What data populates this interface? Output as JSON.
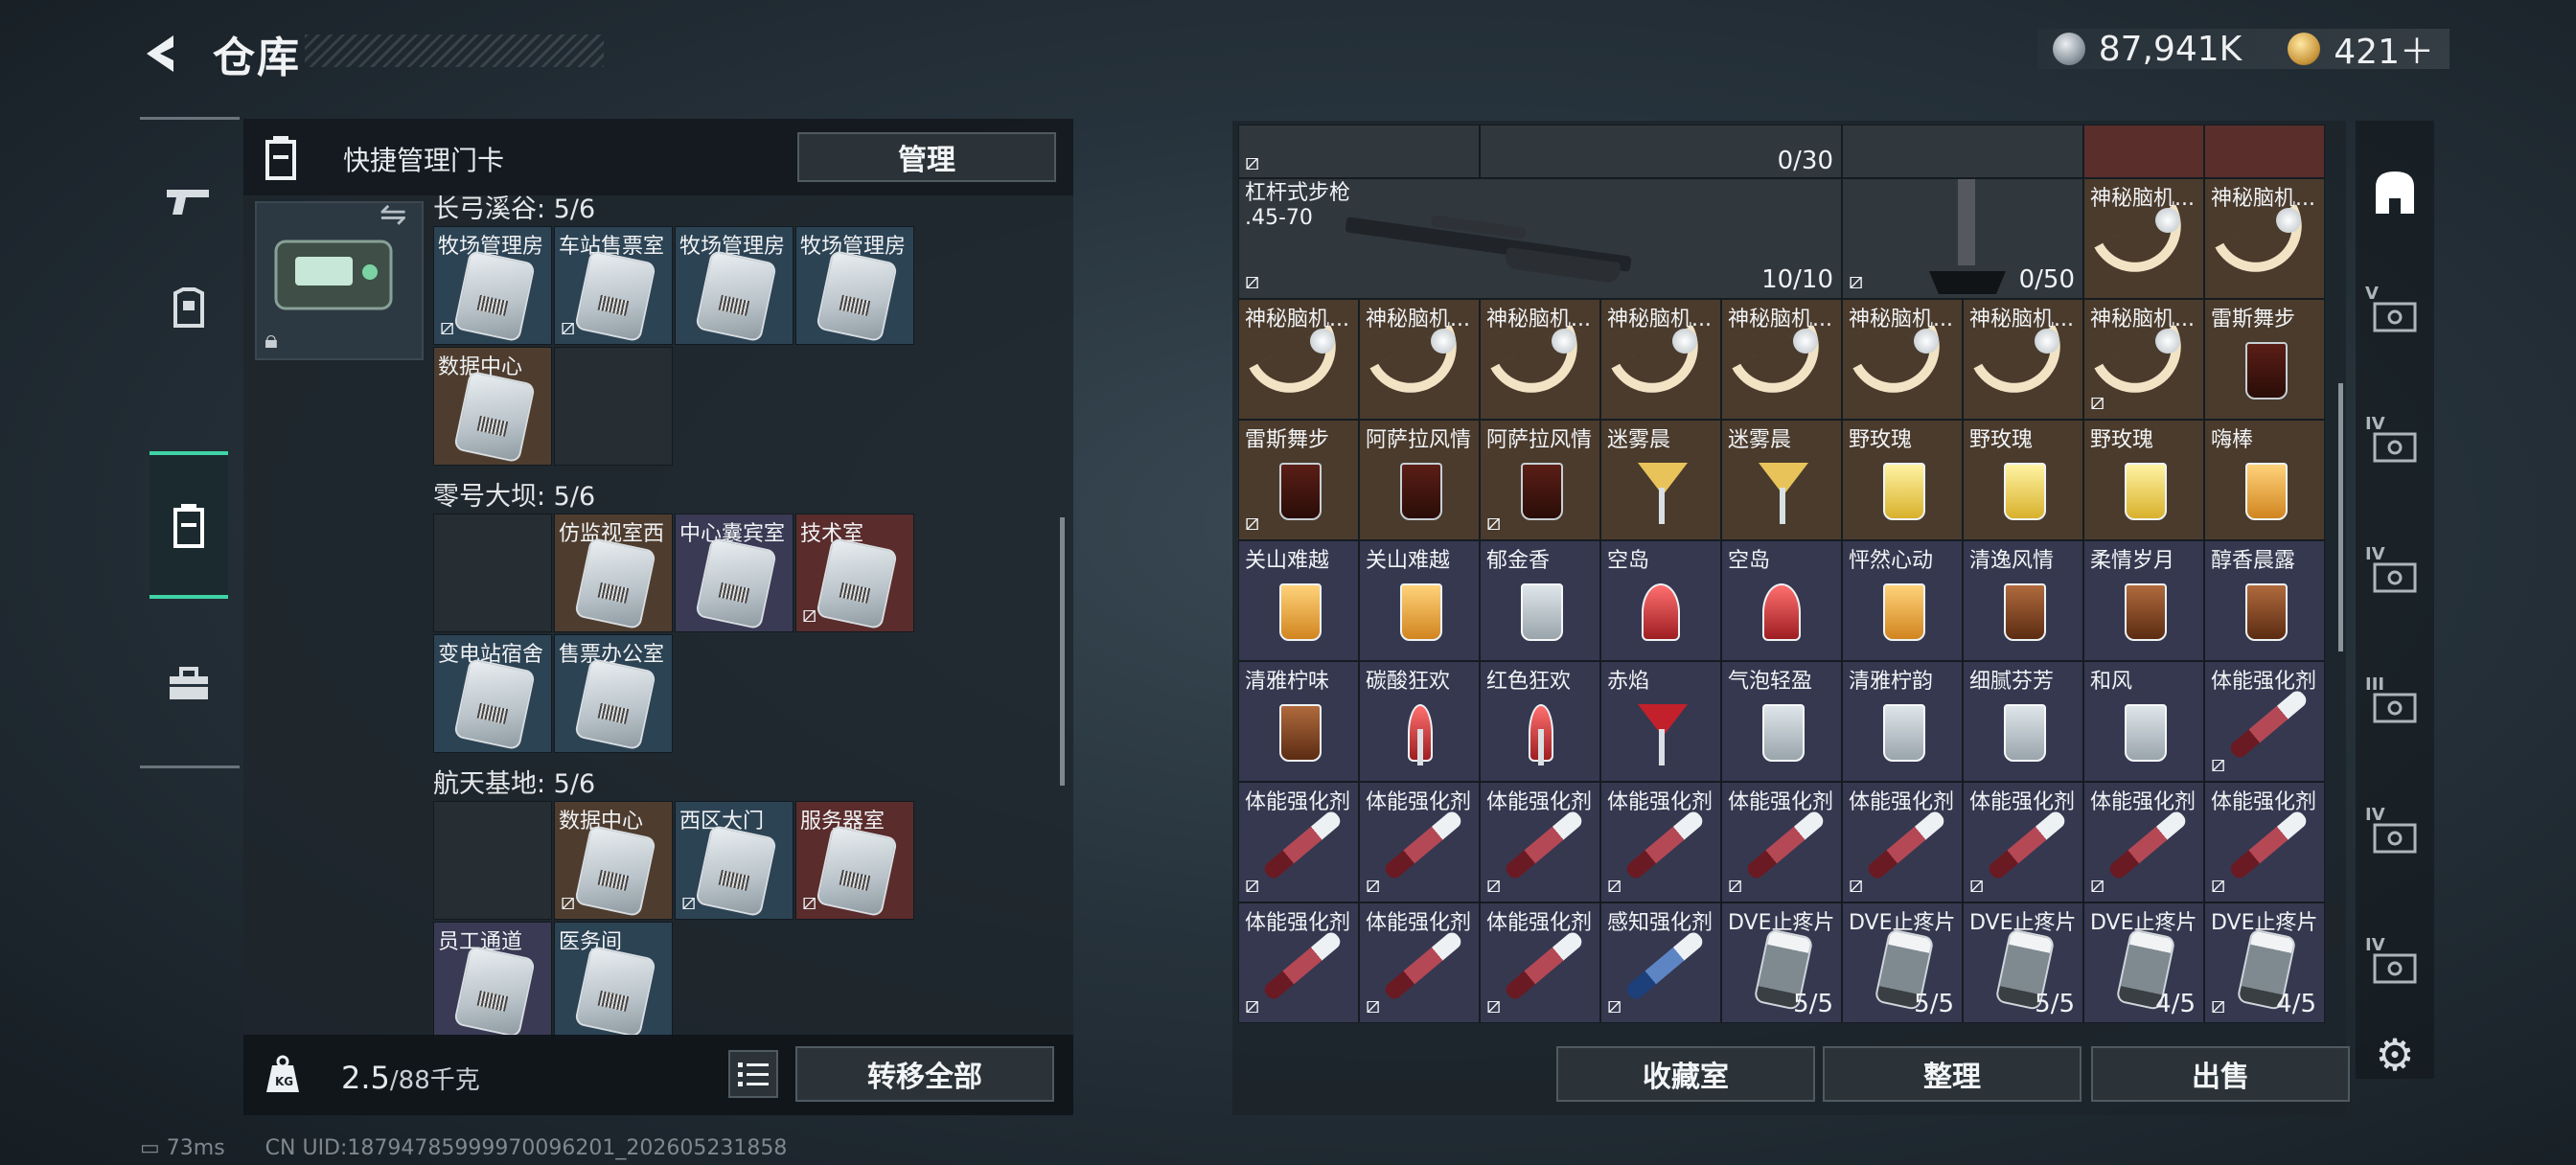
{
  "header": {
    "title": "仓库",
    "silver_amount": "87,941K",
    "gold_amount": "421＋",
    "silver_icon": "silver-coin-icon",
    "gold_icon": "gold-coin-icon"
  },
  "category_bar": {
    "items": [
      {
        "icon": "pistol-icon",
        "active": false
      },
      {
        "icon": "armor-icon",
        "active": false
      },
      {
        "icon": "keycard-case-icon",
        "active": true
      },
      {
        "icon": "toolbox-icon",
        "active": false
      }
    ]
  },
  "left_panel": {
    "header_label": "快捷管理门卡",
    "manage_label": "管理",
    "sections": [
      {
        "title": "长弓溪谷: 5/6",
        "cards": [
          {
            "label": "牧场管理房",
            "color": "blue",
            "flag": true
          },
          {
            "label": "车站售票室",
            "color": "blue",
            "flag": true
          },
          {
            "label": "牧场管理房",
            "color": "blue",
            "flag": false
          },
          {
            "label": "牧场管理房",
            "color": "blue",
            "flag": false
          },
          {
            "label": "数据中心",
            "color": "brown",
            "flag": false
          },
          {
            "label": "",
            "color": "empty",
            "flag": false
          }
        ]
      },
      {
        "title": "零号大坝: 5/6",
        "cards": [
          {
            "label": "",
            "color": "empty",
            "flag": false
          },
          {
            "label": "仿监视室西",
            "color": "brown",
            "flag": false
          },
          {
            "label": "中心囊宾室",
            "color": "purple",
            "flag": false
          },
          {
            "label": "技术室",
            "color": "red",
            "flag": true
          },
          {
            "label": "变电站宿舍",
            "color": "blue",
            "flag": false
          },
          {
            "label": "售票办公室",
            "color": "blue",
            "flag": false
          }
        ]
      },
      {
        "title": "航天基地: 5/6",
        "cards": [
          {
            "label": "",
            "color": "empty",
            "flag": false
          },
          {
            "label": "数据中心",
            "color": "brown",
            "flag": true
          },
          {
            "label": "西区大门",
            "color": "blue",
            "flag": true
          },
          {
            "label": "服务器室",
            "color": "red",
            "flag": true
          },
          {
            "label": "员工通道",
            "color": "purple",
            "flag": false
          },
          {
            "label": "医务间",
            "color": "blue",
            "flag": false
          }
        ]
      }
    ],
    "weight_value": "2.5",
    "weight_unit": "/88千克",
    "transfer_label": "转移全部"
  },
  "grid": {
    "row0": [
      {
        "label": "",
        "count": "",
        "color": "dark",
        "flag": true
      },
      {
        "label": "",
        "count": "0/30",
        "color": "dark",
        "flag": false
      }
    ],
    "rifle_label": "杠杆式步枪\n.45-70",
    "rifle_count": "10/10",
    "stand_count": "0/50",
    "rows": [
      [
        {
          "label": "神秘脑机...",
          "icon": "brain",
          "color": "brown",
          "flag": false
        },
        {
          "label": "神秘脑机...",
          "icon": "brain",
          "color": "brown",
          "flag": false
        },
        {
          "label": "神秘脑机...",
          "icon": "brain",
          "color": "brown",
          "flag": false
        },
        {
          "label": "神秘脑机...",
          "icon": "brain",
          "color": "brown",
          "flag": false
        },
        {
          "label": "神秘脑机...",
          "icon": "brain",
          "color": "brown",
          "flag": false
        },
        {
          "label": "神秘脑机...",
          "icon": "brain",
          "color": "brown",
          "flag": false
        },
        {
          "label": "神秘脑机...",
          "icon": "brain",
          "color": "brown",
          "flag": false
        },
        {
          "label": "神秘脑机...",
          "icon": "brain",
          "color": "brown",
          "flag": true
        },
        {
          "label": "雷斯舞步",
          "icon": "dark",
          "color": "brown",
          "flag": false
        }
      ],
      [
        {
          "label": "雷斯舞步",
          "icon": "dark",
          "color": "brown",
          "flag": true
        },
        {
          "label": "阿萨拉风情",
          "icon": "dark",
          "color": "brown",
          "flag": false
        },
        {
          "label": "阿萨拉风情",
          "icon": "dark",
          "color": "brown",
          "flag": true
        },
        {
          "label": "迷雾晨",
          "icon": "yellowstem",
          "color": "brown",
          "flag": false
        },
        {
          "label": "迷雾晨",
          "icon": "yellowstem",
          "color": "brown",
          "flag": false
        },
        {
          "label": "野玫瑰",
          "icon": "yellow",
          "color": "brown",
          "flag": false
        },
        {
          "label": "野玫瑰",
          "icon": "yellow",
          "color": "brown",
          "flag": false
        },
        {
          "label": "野玫瑰",
          "icon": "yellow",
          "color": "brown",
          "flag": false
        },
        {
          "label": "嗨棒",
          "icon": "amber",
          "color": "brown",
          "flag": false
        }
      ],
      [
        {
          "label": "关山难越",
          "icon": "amber",
          "color": "purple",
          "flag": false
        },
        {
          "label": "关山难越",
          "icon": "amber",
          "color": "purple",
          "flag": false
        },
        {
          "label": "郁金香",
          "icon": "clear",
          "color": "purple",
          "flag": false
        },
        {
          "label": "空岛",
          "icon": "red",
          "color": "purple",
          "flag": false
        },
        {
          "label": "空岛",
          "icon": "red",
          "color": "purple",
          "flag": false
        },
        {
          "label": "怦然心动",
          "icon": "amber",
          "color": "purple",
          "flag": false
        },
        {
          "label": "清逸风情",
          "icon": "brownglass",
          "color": "purple",
          "flag": false
        },
        {
          "label": "柔情岁月",
          "icon": "brownglass",
          "color": "purple",
          "flag": false
        },
        {
          "label": "醇香晨露",
          "icon": "brownglass",
          "color": "purple",
          "flag": false
        }
      ],
      [
        {
          "label": "清雅柠味",
          "icon": "brownglass",
          "color": "purple",
          "flag": false
        },
        {
          "label": "碳酸狂欢",
          "icon": "redstem",
          "color": "purple",
          "flag": false
        },
        {
          "label": "红色狂欢",
          "icon": "redstem",
          "color": "purple",
          "flag": false
        },
        {
          "label": "赤焰",
          "icon": "cocktail",
          "color": "purple",
          "flag": false
        },
        {
          "label": "气泡轻盈",
          "icon": "clear",
          "color": "purple",
          "flag": false
        },
        {
          "label": "清雅柠韵",
          "icon": "clear",
          "color": "purple",
          "flag": false
        },
        {
          "label": "细腻芬芳",
          "icon": "clear",
          "color": "purple",
          "flag": false
        },
        {
          "label": "和风",
          "icon": "clear",
          "color": "purple",
          "flag": false
        },
        {
          "label": "体能强化剂",
          "icon": "syringe",
          "color": "purple",
          "flag": true
        }
      ],
      [
        {
          "label": "体能强化剂",
          "icon": "syringe",
          "color": "purple",
          "flag": true
        },
        {
          "label": "体能强化剂",
          "icon": "syringe",
          "color": "purple",
          "flag": true
        },
        {
          "label": "体能强化剂",
          "icon": "syringe",
          "color": "purple",
          "flag": true
        },
        {
          "label": "体能强化剂",
          "icon": "syringe",
          "color": "purple",
          "flag": true
        },
        {
          "label": "体能强化剂",
          "icon": "syringe",
          "color": "purple",
          "flag": true
        },
        {
          "label": "体能强化剂",
          "icon": "syringe",
          "color": "purple",
          "flag": true
        },
        {
          "label": "体能强化剂",
          "icon": "syringe",
          "color": "purple",
          "flag": true
        },
        {
          "label": "体能强化剂",
          "icon": "syringe",
          "color": "purple",
          "flag": true
        },
        {
          "label": "体能强化剂",
          "icon": "syringe",
          "color": "purple",
          "flag": true
        }
      ],
      [
        {
          "label": "体能强化剂",
          "icon": "syringe",
          "color": "purple",
          "flag": true
        },
        {
          "label": "体能强化剂",
          "icon": "syringe",
          "color": "purple",
          "flag": true
        },
        {
          "label": "体能强化剂",
          "icon": "syringe",
          "color": "purple",
          "flag": true
        },
        {
          "label": "感知强化剂",
          "icon": "syringeblue",
          "color": "purple",
          "flag": true
        },
        {
          "label": "DVE止疼片",
          "icon": "pill",
          "color": "purple",
          "flag": false,
          "count": "5/5"
        },
        {
          "label": "DVE止疼片",
          "icon": "pill",
          "color": "purple",
          "flag": false,
          "count": "5/5"
        },
        {
          "label": "DVE止疼片",
          "icon": "pill",
          "color": "purple",
          "flag": false,
          "count": "5/5"
        },
        {
          "label": "DVE止疼片",
          "icon": "pill",
          "color": "purple",
          "flag": false,
          "count": "4/5"
        },
        {
          "label": "DVE止疼片",
          "icon": "pill",
          "color": "purple",
          "flag": true,
          "count": "4/5"
        }
      ]
    ],
    "top_right_labels": [
      "神秘脑机...",
      "神秘脑机..."
    ]
  },
  "footer_buttons": {
    "collection": "收藏室",
    "organize": "整理",
    "sell": "出售"
  },
  "right_column": {
    "levels": [
      "V",
      "IV",
      "IV",
      "III",
      "IV",
      "IV"
    ]
  },
  "status_bar": {
    "ping": "73ms",
    "uid": "CN UID:18794785999970096201_202605231858"
  }
}
